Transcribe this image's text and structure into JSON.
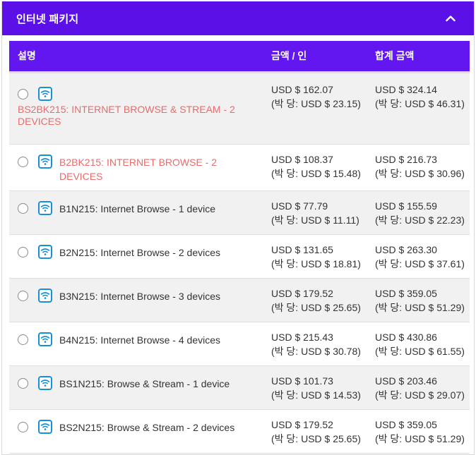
{
  "panel": {
    "title": "인터넷 패키지",
    "collapse_icon": "chevron-up-icon"
  },
  "table": {
    "headers": {
      "description": "설명",
      "price": "금액 / 인",
      "total": "합계 금액"
    },
    "rows": [
      {
        "name": "BS2BK215: INTERNET BROWSE & STREAM - 2 DEVICES",
        "price": "USD $ 162.07",
        "price_per_night": "(박 당: USD $ 23.15)",
        "total": "USD $ 324.14",
        "total_per_night": "(박 당: USD $ 46.31)"
      },
      {
        "name": "B2BK215: INTERNET BROWSE - 2 DEVICES",
        "price": "USD $ 108.37",
        "price_per_night": "(박 당: USD $ 15.48)",
        "total": "USD $ 216.73",
        "total_per_night": "(박 당: USD $ 30.96)"
      },
      {
        "name": "B1N215: Internet Browse - 1 device",
        "price": "USD $ 77.79",
        "price_per_night": "(박 당: USD $ 11.11)",
        "total": "USD $ 155.59",
        "total_per_night": "(박 당: USD $ 22.23)"
      },
      {
        "name": "B2N215: Internet Browse - 2 devices",
        "price": "USD $ 131.65",
        "price_per_night": "(박 당: USD $ 18.81)",
        "total": "USD $ 263.30",
        "total_per_night": "(박 당: USD $ 37.61)"
      },
      {
        "name": "B3N215: Internet Browse - 3 devices",
        "price": "USD $ 179.52",
        "price_per_night": "(박 당: USD $ 25.65)",
        "total": "USD $ 359.05",
        "total_per_night": "(박 당: USD $ 51.29)"
      },
      {
        "name": "B4N215: Internet Browse - 4 devices",
        "price": "USD $ 215.43",
        "price_per_night": "(박 당: USD $ 30.78)",
        "total": "USD $ 430.86",
        "total_per_night": "(박 당: USD $ 61.55)"
      },
      {
        "name": "BS1N215: Browse & Stream - 1 device",
        "price": "USD $ 101.73",
        "price_per_night": "(박 당: USD $ 14.53)",
        "total": "USD $ 203.46",
        "total_per_night": "(박 당: USD $ 29.07)"
      },
      {
        "name": "BS2N215: Browse & Stream - 2 devices",
        "price": "USD $ 179.52",
        "price_per_night": "(박 당: USD $ 25.65)",
        "total": "USD $ 359.05",
        "total_per_night": "(박 당: USD $ 51.29)"
      }
    ]
  },
  "colors": {
    "header_bg": "#5b10e8",
    "table_header_bg": "#6317f0",
    "special_text": "#e86b6b",
    "wifi_icon": "#1a8fd6"
  },
  "icons": {
    "row_icon": "wifi-icon",
    "selector": "radio-button"
  }
}
